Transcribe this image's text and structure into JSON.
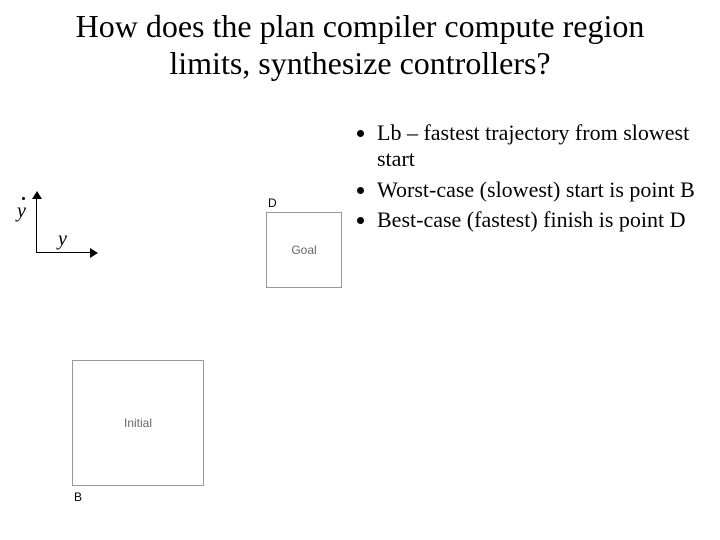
{
  "title": "How does the plan compiler compute region limits, synthesize controllers?",
  "bullets": {
    "b1": "Lb – fastest trajectory from slowest start",
    "b2": "Worst-case (slowest) start is point B",
    "b3": "Best-case (fastest) finish is point D"
  },
  "axes": {
    "ydot": "y",
    "y": "y"
  },
  "goal": {
    "corner": "D",
    "label": "Goal"
  },
  "initial": {
    "label": "Initial",
    "corner": "B"
  }
}
